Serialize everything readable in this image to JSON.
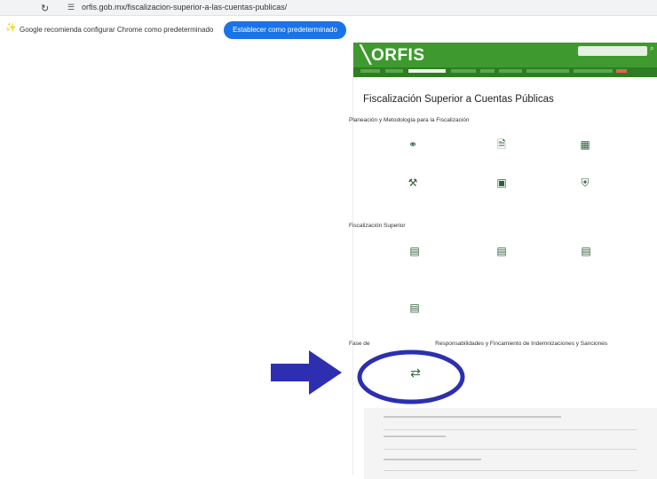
{
  "browser": {
    "url": "orfis.gob.mx/fiscalizacion-superior-a-las-cuentas-publicas/",
    "infobar_message": "Google recomienda configurar Chrome como predeterminado",
    "infobar_button": "Establecer como predeterminado"
  },
  "site": {
    "logo": "ORFIS",
    "page_title": "Fiscalización Superior a Cuentas Públicas",
    "sections": [
      {
        "title": "Planeación y Metodología para la Fiscalización"
      },
      {
        "title": "Fiscalización Superior"
      },
      {
        "title_left": "Fase de",
        "title_right": "Responsabilidades y Fincamiento de Indemnizaciones y Sanciones"
      }
    ]
  },
  "colors": {
    "header_green": "#3e9a2f",
    "nav_green": "#2e7d22",
    "chrome_button": "#1a73e8",
    "annotation_blue": "#2d2fb0"
  },
  "icons": {
    "row1": [
      "handshake-icon",
      "document-icon",
      "calendar-icon"
    ],
    "row2": [
      "gavel-icon",
      "image-icon",
      "shield-icon"
    ],
    "row3": [
      "report-icon",
      "report-icon",
      "report-icon"
    ],
    "row4": [
      "report-icon"
    ],
    "row5": [
      "transfer-arrows-icon"
    ]
  }
}
